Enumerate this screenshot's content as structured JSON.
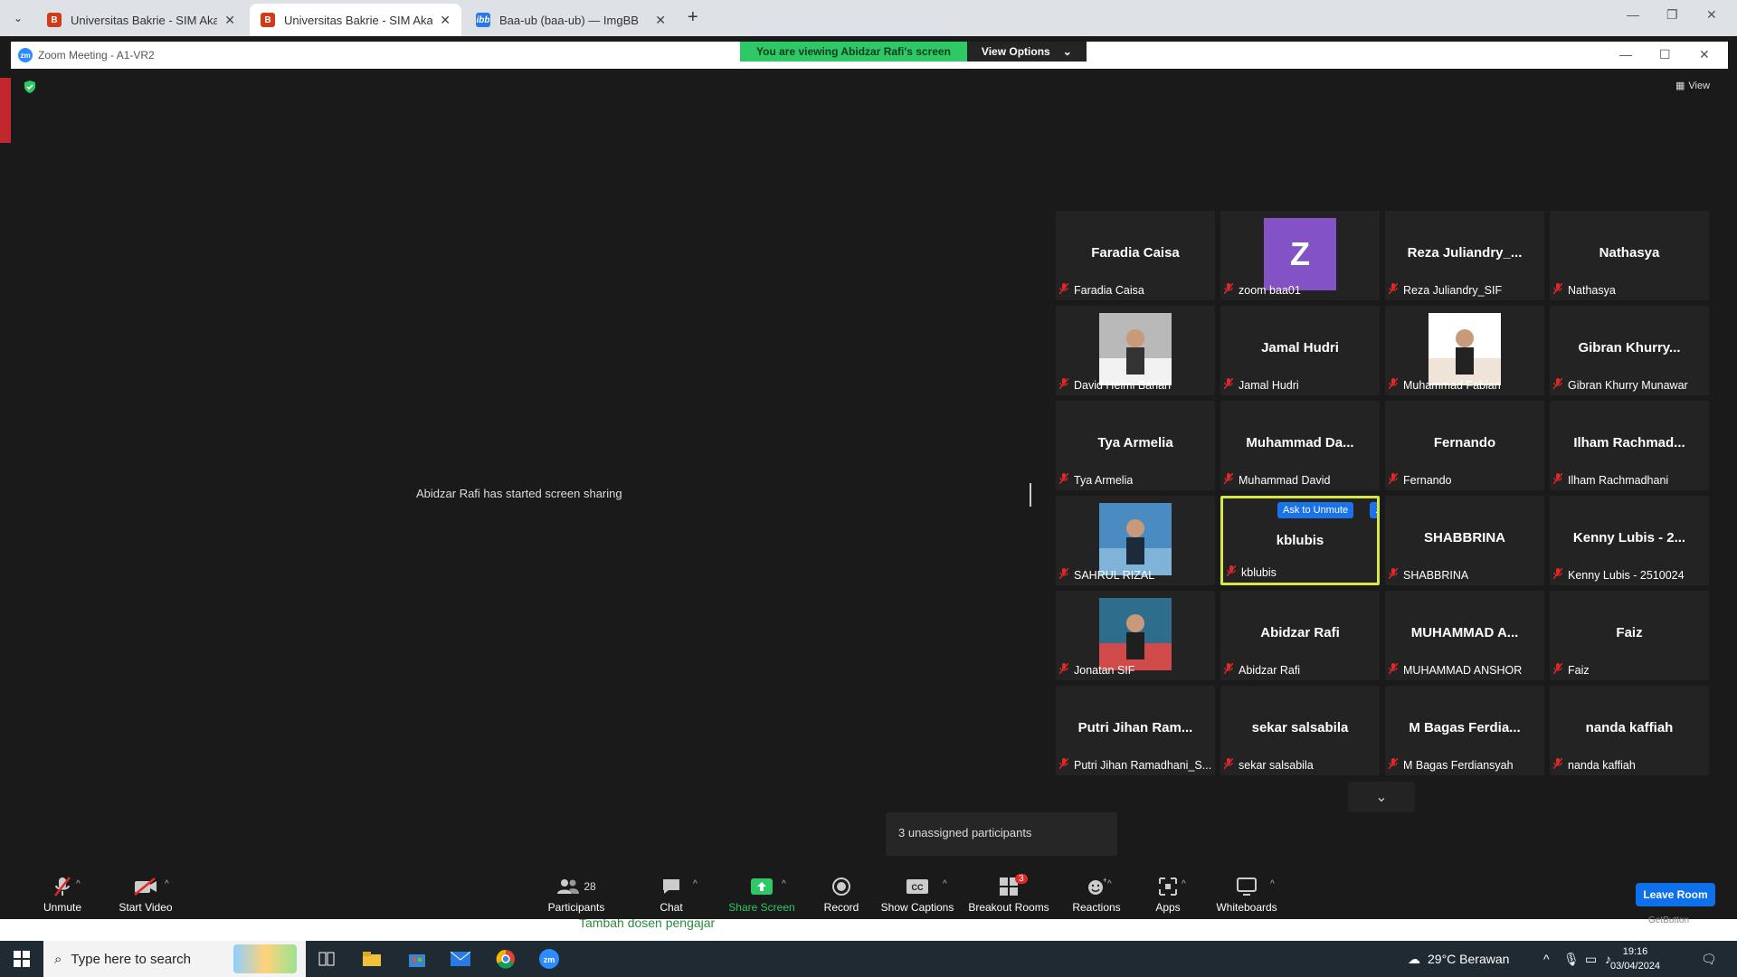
{
  "browser": {
    "tabs": [
      {
        "title": "Universitas Bakrie - SIM Akadem",
        "fav": "UB",
        "active": false
      },
      {
        "title": "Universitas Bakrie - SIM Akadem",
        "fav": "UB",
        "active": true
      },
      {
        "title": "Baa-ub (baa-ub) — ImgBB",
        "fav": "ibb",
        "active": false
      }
    ]
  },
  "zoom": {
    "window_title": "Zoom Meeting - A1-VR2",
    "banner": {
      "viewing": "You are viewing Abidzar Rafi's screen",
      "options": "View Options"
    },
    "view_label": "View",
    "share_message": "Abidzar Rafi has started screen sharing",
    "unassigned": "3 unassigned participants",
    "leave_room": "Leave Room",
    "getbutton": "GetButton",
    "participants": [
      {
        "big": "Faradia Caisa",
        "name": "Faradia Caisa",
        "type": "text"
      },
      {
        "big": "Z",
        "name": "zoom baa01",
        "type": "letter"
      },
      {
        "big": "Reza Juliandry_...",
        "name": "Reza Juliandry_SIF",
        "type": "text"
      },
      {
        "big": "Nathasya",
        "name": "Nathasya",
        "type": "text"
      },
      {
        "big": "",
        "name": "David Helmi Bahari",
        "type": "photo",
        "photo": "david"
      },
      {
        "big": "Jamal Hudri",
        "name": "Jamal Hudri",
        "type": "text"
      },
      {
        "big": "",
        "name": "Muhammad Fabian",
        "type": "photo",
        "photo": "fabian"
      },
      {
        "big": "Gibran Khurry...",
        "name": "Gibran Khurry Munawar",
        "type": "text"
      },
      {
        "big": "Tya Armelia",
        "name": "Tya Armelia",
        "type": "text"
      },
      {
        "big": "Muhammad Da...",
        "name": "Muhammad David",
        "type": "text"
      },
      {
        "big": "Fernando",
        "name": "Fernando",
        "type": "text"
      },
      {
        "big": "Ilham Rachmad...",
        "name": "Ilham Rachmadhani",
        "type": "text"
      },
      {
        "big": "",
        "name": "SAHRUL RIZAL",
        "type": "photo",
        "photo": "sahrul"
      },
      {
        "big": "kblubis",
        "name": "kblubis",
        "type": "active",
        "ask": "Ask to Unmute",
        "more": "..."
      },
      {
        "big": "SHABBRINA",
        "name": "SHABBRINA",
        "type": "text"
      },
      {
        "big": "Kenny Lubis - 2...",
        "name": "Kenny Lubis - 2510024",
        "type": "text"
      },
      {
        "big": "",
        "name": "Jonatan SIF",
        "type": "photo",
        "photo": "jonatan"
      },
      {
        "big": "Abidzar Rafi",
        "name": "Abidzar Rafi",
        "type": "text"
      },
      {
        "big": "MUHAMMAD A...",
        "name": "MUHAMMAD ANSHOR",
        "type": "text"
      },
      {
        "big": "Faiz",
        "name": "Faiz",
        "type": "text"
      },
      {
        "big": "Putri Jihan Ram...",
        "name": "Putri Jihan Ramadhani_S...",
        "type": "text"
      },
      {
        "big": "sekar salsabila",
        "name": "sekar salsabila",
        "type": "text"
      },
      {
        "big": "M Bagas Ferdia...",
        "name": "M Bagas Ferdiansyah",
        "type": "text"
      },
      {
        "big": "nanda kaffiah",
        "name": "nanda kaffiah",
        "type": "text"
      }
    ],
    "toolbar": {
      "unmute": "Unmute",
      "start_video": "Start Video",
      "participants": "Participants",
      "participants_count": "28",
      "chat": "Chat",
      "share_screen": "Share Screen",
      "record": "Record",
      "show_captions": "Show Captions",
      "breakout_rooms": "Breakout Rooms",
      "breakout_badge": "3",
      "reactions": "Reactions",
      "apps": "Apps",
      "whiteboards": "Whiteboards"
    }
  },
  "behind_page_text": "Tambah dosen pengajar",
  "taskbar": {
    "search_placeholder": "Type here to search",
    "weather": "29°C  Berawan",
    "time": "19:16",
    "date": "03/04/2024"
  },
  "colors": {
    "zoom_bg": "#1a1a1a",
    "tile_bg": "#232323",
    "active_border": "#d7e842",
    "share_green": "#2ec866",
    "zoom_blue": "#0e71eb",
    "mic_red": "#e02828"
  }
}
